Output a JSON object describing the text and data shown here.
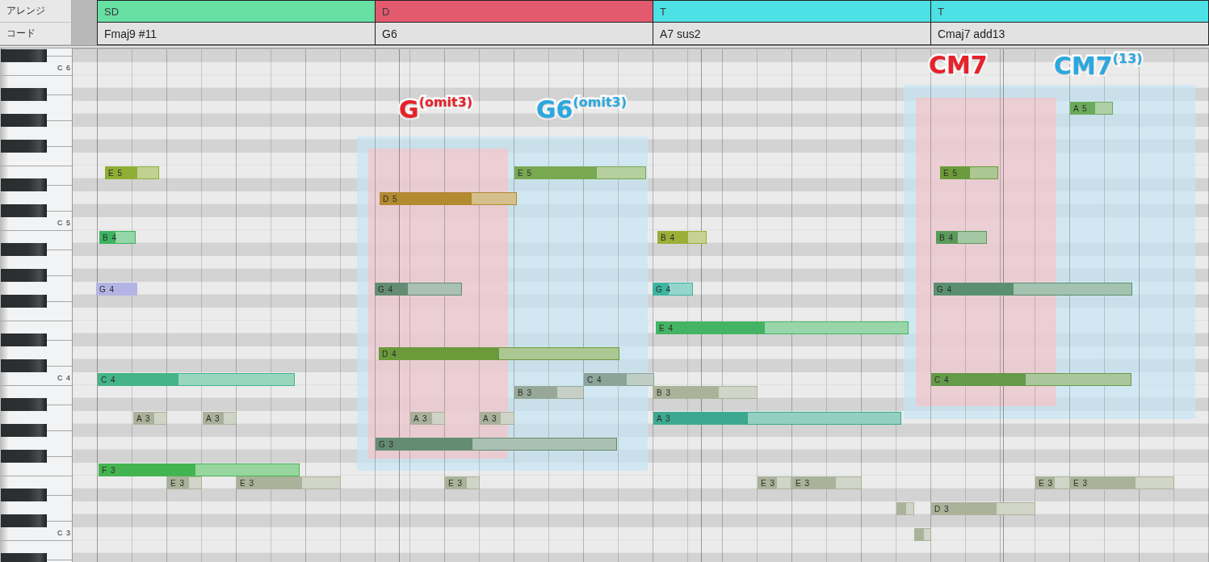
{
  "tracks": {
    "arrange_label": "アレンジ",
    "chord_label": "コード"
  },
  "arrange": [
    {
      "label": "SD",
      "color": "#66e0a3"
    },
    {
      "label": "D",
      "color": "#e35a6e"
    },
    {
      "label": "T",
      "color": "#4de0e4"
    },
    {
      "label": "T",
      "color": "#4de0e4"
    }
  ],
  "chords": [
    {
      "label": "Fmaj9 #11"
    },
    {
      "label": "G6"
    },
    {
      "label": "A7 sus2"
    },
    {
      "label": "Cmaj7 add13"
    }
  ],
  "keyboard": {
    "octave_labels": [
      "C 6",
      "C 5",
      "C 4",
      "C 3"
    ]
  },
  "overlays": [
    {
      "label": "G$^{(omit3)}$",
      "color": "#e8202a"
    },
    {
      "label": "G6$^{(omit3)}$",
      "color": "#2aa8e0"
    },
    {
      "label": "CM7",
      "color": "#e8202a"
    },
    {
      "label": "CM7$^{(13)}$",
      "color": "#2aa8e0"
    }
  ],
  "notes": [
    {
      "label": "E 5",
      "level": 0.6,
      "color": "#8fae35"
    },
    {
      "label": "B 4",
      "level": 0.44,
      "color": "#3cb460"
    },
    {
      "label": "G 4",
      "level": 1,
      "color": "#b4b4e4"
    },
    {
      "label": "C 4",
      "level": 0.41,
      "color": "#44b488"
    },
    {
      "label": "A 3",
      "level": 0.62,
      "color": "#aab09a"
    },
    {
      "label": "A 3",
      "level": 0.62,
      "color": "#aab09a"
    },
    {
      "label": "F 3",
      "level": 0.48,
      "color": "#44b450"
    },
    {
      "label": "E 3",
      "level": 0.63,
      "color": "#aab39a"
    },
    {
      "label": "E 3",
      "level": 0.63,
      "color": "#aab39a"
    },
    {
      "label": "D 5",
      "level": 0.67,
      "color": "#b28a30"
    },
    {
      "label": "G 4",
      "level": 0.38,
      "color": "#648c73"
    },
    {
      "label": "D 4",
      "level": 0.5,
      "color": "#6a9a3a"
    },
    {
      "label": "A 3",
      "level": 0.63,
      "color": "#aab09a"
    },
    {
      "label": "A 3",
      "level": 0.6,
      "color": "#aab09a"
    },
    {
      "label": "G 3",
      "level": 0.4,
      "color": "#648c73"
    },
    {
      "label": "E 3",
      "level": 0.63,
      "color": "#aab39a"
    },
    {
      "label": "E 5",
      "level": 0.63,
      "color": "#78a850"
    },
    {
      "label": "C 4",
      "level": 0.61,
      "color": "#8aa49a"
    },
    {
      "label": "B 3",
      "level": 0.62,
      "color": "#98a898"
    },
    {
      "label": "B 4",
      "level": 0.62,
      "color": "#9aae38"
    },
    {
      "label": "G 4",
      "level": 0.4,
      "color": "#3cb4a0"
    },
    {
      "label": "E 4",
      "level": 0.43,
      "color": "#44b464"
    },
    {
      "label": "B 3",
      "level": 0.63,
      "color": "#aab39a"
    },
    {
      "label": "A 3",
      "level": 0.38,
      "color": "#3ca890"
    },
    {
      "label": "E 3",
      "level": 0.57,
      "color": "#aab39a"
    },
    {
      "label": "E 3",
      "level": 0.63,
      "color": "#aab39a"
    },
    {
      "level": 0.55,
      "color": "#aab39a"
    },
    {
      "level": 0.6,
      "color": "#aab39a"
    },
    {
      "label": "E 5",
      "level": 0.51,
      "color": "#6a9a3a"
    },
    {
      "label": "B 4",
      "level": 0.43,
      "color": "#5a9a5a"
    },
    {
      "label": "G 4",
      "level": 0.4,
      "color": "#5a9070"
    },
    {
      "label": "C 4",
      "level": 0.47,
      "color": "#649a4a"
    },
    {
      "label": "D 3",
      "level": 0.63,
      "color": "#aab39a"
    },
    {
      "label": "A 5",
      "level": 0.58,
      "color": "#6aaa5a"
    },
    {
      "label": "E 3",
      "level": 0.56,
      "color": "#aab39a"
    },
    {
      "label": "E 3",
      "level": 0.63,
      "color": "#aab39a"
    }
  ]
}
